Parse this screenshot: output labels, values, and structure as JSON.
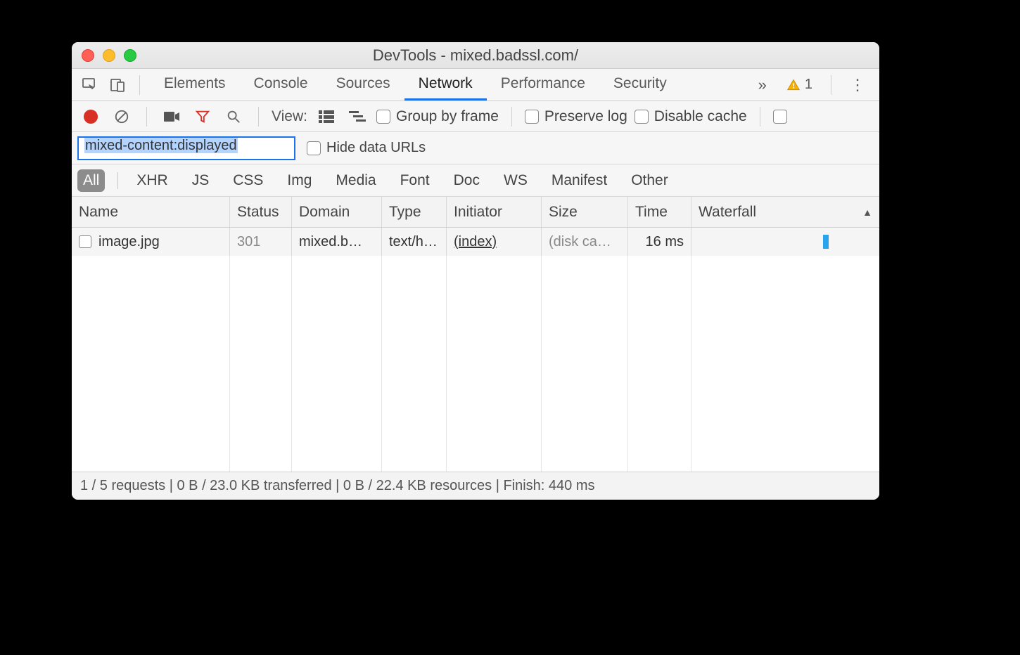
{
  "window": {
    "title": "DevTools - mixed.badssl.com/"
  },
  "main_tabs": {
    "items": [
      "Elements",
      "Console",
      "Sources",
      "Network",
      "Performance",
      "Security"
    ],
    "active": "Network",
    "more_label": "»",
    "warning_count": "1"
  },
  "toolbar": {
    "view_label": "View:",
    "group_by_frame": "Group by frame",
    "preserve_log": "Preserve log",
    "disable_cache": "Disable cache"
  },
  "filter": {
    "value": "mixed-content:displayed",
    "hide_data_urls": "Hide data URLs"
  },
  "type_filters": {
    "items": [
      "All",
      "XHR",
      "JS",
      "CSS",
      "Img",
      "Media",
      "Font",
      "Doc",
      "WS",
      "Manifest",
      "Other"
    ],
    "active": "All"
  },
  "columns": {
    "name": "Name",
    "status": "Status",
    "domain": "Domain",
    "type": "Type",
    "initiator": "Initiator",
    "size": "Size",
    "time": "Time",
    "waterfall": "Waterfall"
  },
  "rows": [
    {
      "name": "image.jpg",
      "status": "301",
      "domain": "mixed.b…",
      "type": "text/h…",
      "initiator": "(index)",
      "size": "(disk ca…",
      "time": "16 ms",
      "waterfall": {
        "left_pct": 70,
        "width_pct": 3
      }
    }
  ],
  "statusbar": {
    "text": "1 / 5 requests | 0 B / 23.0 KB transferred | 0 B / 22.4 KB resources | Finish: 440 ms"
  }
}
